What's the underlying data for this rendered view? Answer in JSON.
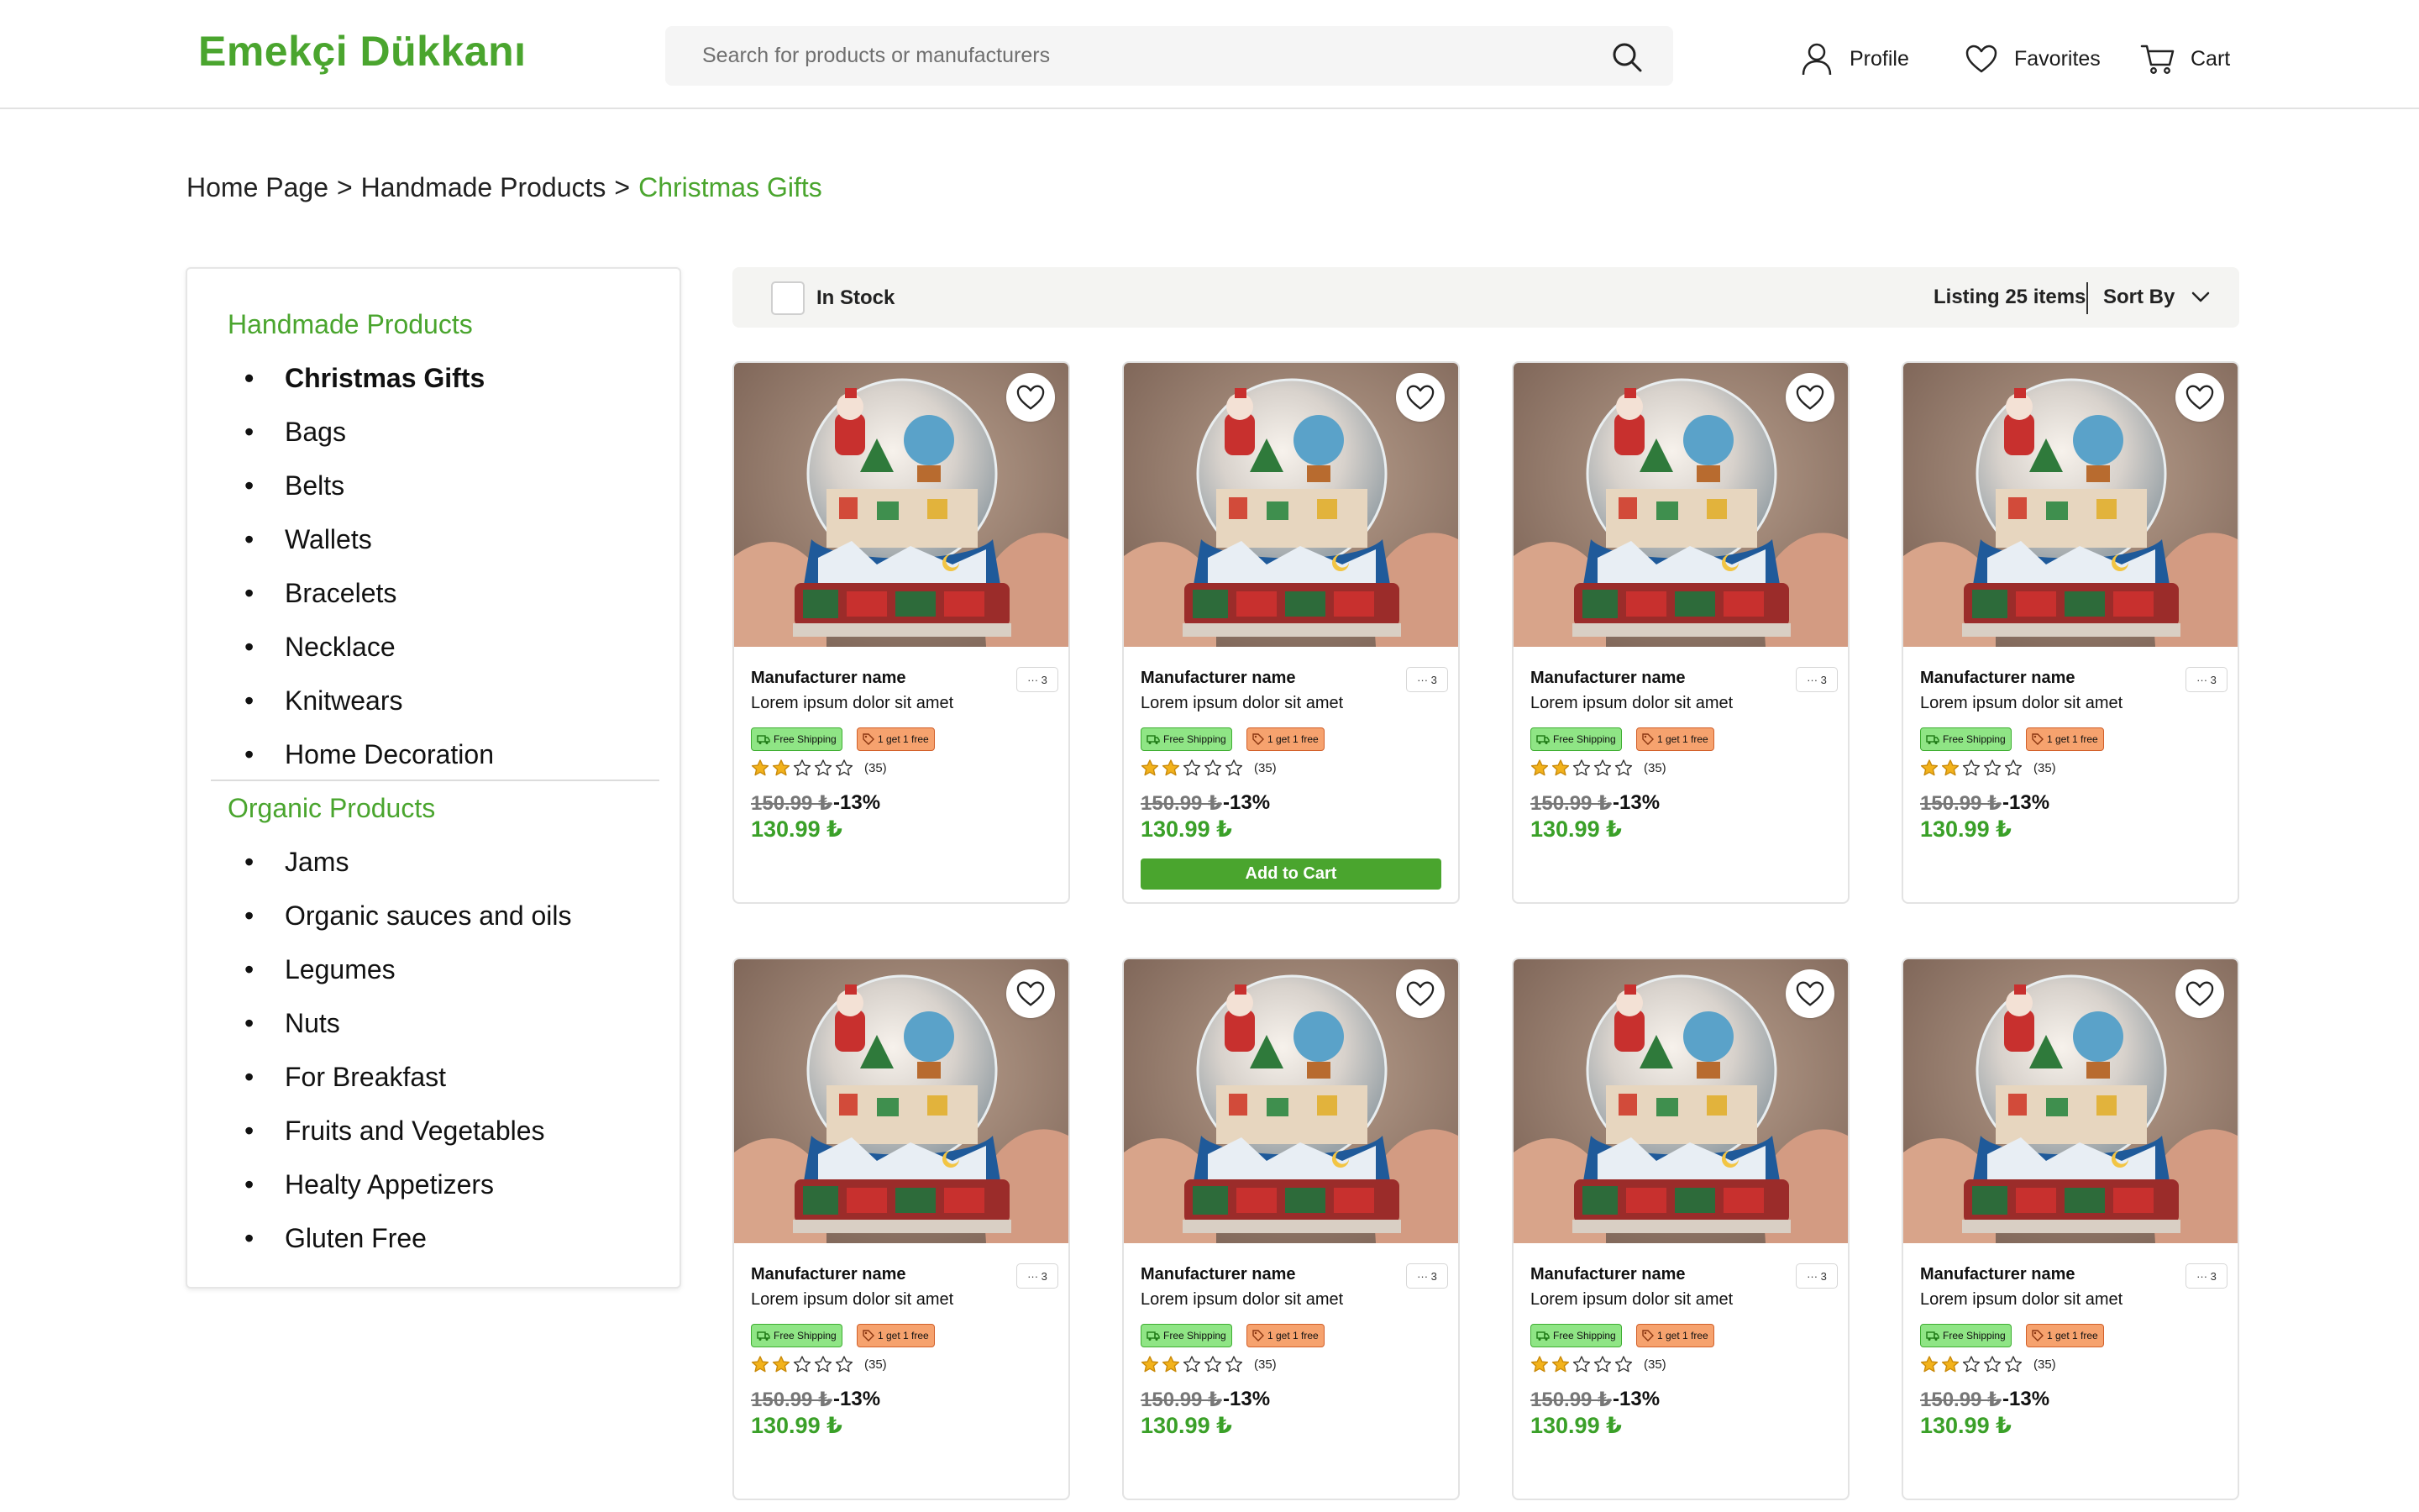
{
  "header": {
    "logo": "Emekçi Dükkanı",
    "search_placeholder": "Search for products or manufacturers",
    "nav": {
      "profile": "Profile",
      "favorites": "Favorites",
      "cart": "Cart"
    }
  },
  "breadcrumb": {
    "home": "Home Page",
    "category": "Handmade Products",
    "current": "Christmas Gifts",
    "separator": ">"
  },
  "sidebar": {
    "groups": [
      {
        "title": "Handmade Products",
        "items": [
          "Christmas Gifts",
          "Bags",
          "Belts",
          "Wallets",
          "Bracelets",
          "Necklace",
          "Knitwears",
          "Home Decoration"
        ],
        "active": "Christmas Gifts"
      },
      {
        "title": "Organic Products",
        "items": [
          "Jams",
          "Organic sauces and oils",
          "Legumes",
          "Nuts",
          "For Breakfast",
          "Fruits and Vegetables",
          "Healty Appetizers",
          "Gluten Free"
        ]
      }
    ]
  },
  "filter": {
    "in_stock": "In Stock",
    "in_stock_checked": false,
    "listing": "Listing 25 items",
    "sort_by": "Sort By"
  },
  "colors": {
    "brand": "#4aa52e",
    "price": "#3aa028",
    "star": "#f2b21b",
    "ship_badge": "#8fe585",
    "gift_badge": "#f6a26e"
  },
  "products": [
    {
      "maker": "Manufacturer name",
      "title": "Lorem ipsum dolor sit amet",
      "more": "··· 3",
      "badge_ship": "Free Shipping",
      "badge_gift": "1 get 1 free",
      "rating": 2,
      "max_rating": 5,
      "reviews": "(35)",
      "old_price": "150.99 ₺",
      "discount": "-13%",
      "price": "130.99 ₺",
      "show_add_to_cart": false
    },
    {
      "maker": "Manufacturer name",
      "title": "Lorem ipsum dolor sit amet",
      "more": "··· 3",
      "badge_ship": "Free Shipping",
      "badge_gift": "1 get 1 free",
      "rating": 2,
      "max_rating": 5,
      "reviews": "(35)",
      "old_price": "150.99 ₺",
      "discount": "-13%",
      "price": "130.99 ₺",
      "show_add_to_cart": true,
      "add_to_cart": "Add to Cart"
    },
    {
      "maker": "Manufacturer name",
      "title": "Lorem ipsum dolor sit amet",
      "more": "··· 3",
      "badge_ship": "Free Shipping",
      "badge_gift": "1 get 1 free",
      "rating": 2,
      "max_rating": 5,
      "reviews": "(35)",
      "old_price": "150.99 ₺",
      "discount": "-13%",
      "price": "130.99 ₺",
      "show_add_to_cart": false
    },
    {
      "maker": "Manufacturer name",
      "title": "Lorem ipsum dolor sit amet",
      "more": "··· 3",
      "badge_ship": "Free Shipping",
      "badge_gift": "1 get 1 free",
      "rating": 2,
      "max_rating": 5,
      "reviews": "(35)",
      "old_price": "150.99 ₺",
      "discount": "-13%",
      "price": "130.99 ₺",
      "show_add_to_cart": false
    },
    {
      "maker": "Manufacturer name",
      "title": "Lorem ipsum dolor sit amet",
      "more": "··· 3",
      "badge_ship": "Free Shipping",
      "badge_gift": "1 get 1 free",
      "rating": 2,
      "max_rating": 5,
      "reviews": "(35)",
      "old_price": "150.99 ₺",
      "discount": "-13%",
      "price": "130.99 ₺",
      "show_add_to_cart": false
    },
    {
      "maker": "Manufacturer name",
      "title": "Lorem ipsum dolor sit amet",
      "more": "··· 3",
      "badge_ship": "Free Shipping",
      "badge_gift": "1 get 1 free",
      "rating": 2,
      "max_rating": 5,
      "reviews": "(35)",
      "old_price": "150.99 ₺",
      "discount": "-13%",
      "price": "130.99 ₺",
      "show_add_to_cart": false
    },
    {
      "maker": "Manufacturer name",
      "title": "Lorem ipsum dolor sit amet",
      "more": "··· 3",
      "badge_ship": "Free Shipping",
      "badge_gift": "1 get 1 free",
      "rating": 2,
      "max_rating": 5,
      "reviews": "(35)",
      "old_price": "150.99 ₺",
      "discount": "-13%",
      "price": "130.99 ₺",
      "show_add_to_cart": false
    },
    {
      "maker": "Manufacturer name",
      "title": "Lorem ipsum dolor sit amet",
      "more": "··· 3",
      "badge_ship": "Free Shipping",
      "badge_gift": "1 get 1 free",
      "rating": 2,
      "max_rating": 5,
      "reviews": "(35)",
      "old_price": "150.99 ₺",
      "discount": "-13%",
      "price": "130.99 ₺",
      "show_add_to_cart": false
    }
  ]
}
